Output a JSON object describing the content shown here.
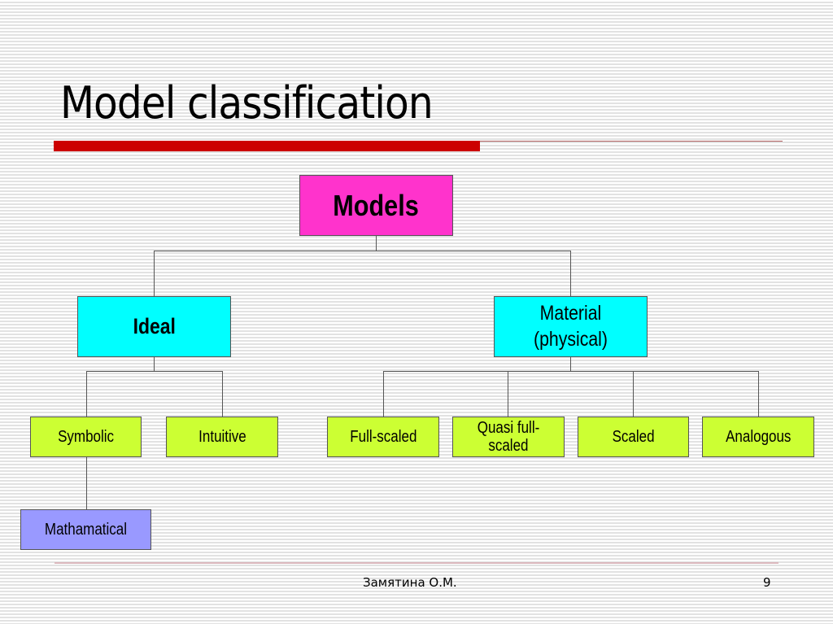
{
  "slide": {
    "title": "Model classification",
    "footer": {
      "author": "Замятина О.М.",
      "page_number": "9"
    },
    "colors": {
      "accent": "#cc0000",
      "root": "#ff33cc",
      "level1": "#00ffff",
      "level2": "#ccff33",
      "level3": "#9999ff"
    }
  },
  "diagram": {
    "root": "Models",
    "ideal": {
      "label": "Ideal",
      "children": [
        "Symbolic",
        "Intuitive"
      ]
    },
    "material": {
      "label": "Material\n(physical)",
      "line1": "Material",
      "line2": "(physical)",
      "children": [
        "Full-scaled",
        "Quasi full-scaled",
        "Scaled",
        "Analogous"
      ]
    },
    "symbolic_child": "Mathamatical",
    "quasi_line1": "Quasi full-",
    "quasi_line2": "scaled"
  }
}
